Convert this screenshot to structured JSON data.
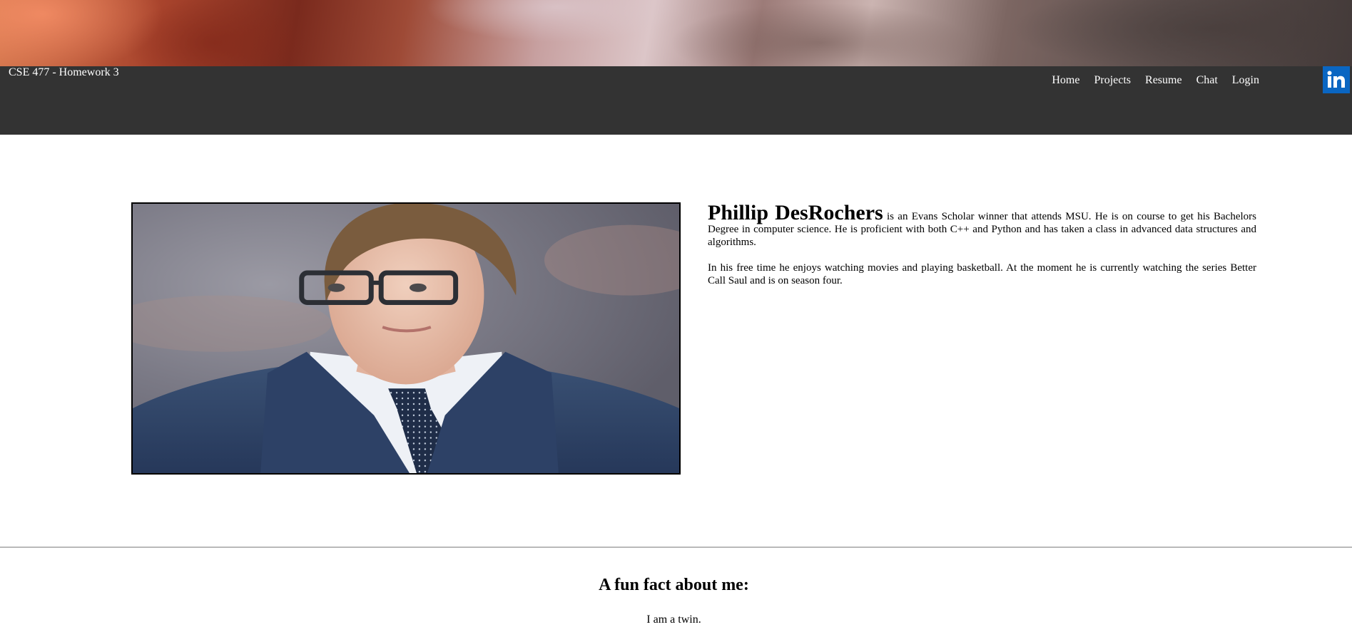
{
  "header": {
    "title": "CSE 477 - Homework 3",
    "nav": [
      "Home",
      "Projects",
      "Resume",
      "Chat",
      "Login"
    ],
    "linkedin_icon": "linkedin-icon",
    "linkedin_label": "in",
    "colors": {
      "navbar": "#333333",
      "linkedin": "#0a66c2"
    }
  },
  "main": {
    "photo_alt": "Portrait of Phillip DesRochers",
    "name": "Phillip DesRochers",
    "bio_1": " is an Evans Scholar winner that attends MSU. He is on course to get his Bachelors Degree in computer science. He is proficient with both C++ and Python and has taken a class in advanced data structures and algorithms.",
    "bio_2": "In his free time he enjoys watching movies and playing basketball. At the moment he is currently watching the series Better Call Saul and is on season four."
  },
  "fun_fact": {
    "title": "A fun fact about me:",
    "text": "I am a twin."
  }
}
